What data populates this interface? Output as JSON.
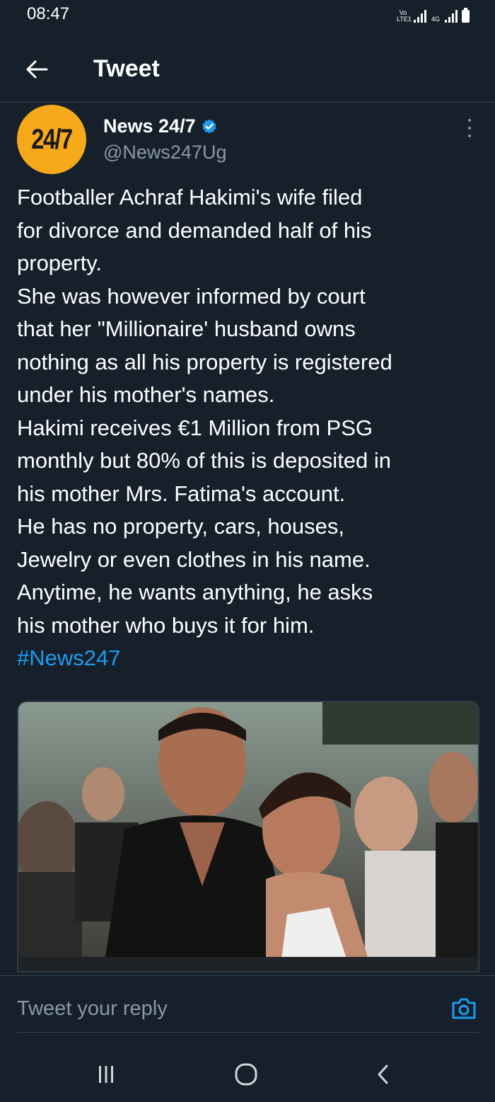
{
  "status_bar": {
    "time": "08:47",
    "carrier_tag_1": "Vo LTE1",
    "carrier_tag_2": "4G"
  },
  "header": {
    "title": "Tweet",
    "back_icon": "arrow-left-icon"
  },
  "tweet": {
    "avatar_text": "24/7",
    "display_name": "News 24/7",
    "verified_icon": "verified-badge-icon",
    "handle": "@News247Ug",
    "body_lines": [
      "Footballer Achraf Hakimi's wife filed",
      "for divorce and demanded half of his",
      "property.",
      "She was however informed by court",
      "that her \"Millionaire' husband owns",
      "nothing as all his property is registered",
      "under his mother's names.",
      "Hakimi receives €1 Million from PSG",
      "monthly but 80% of this is deposited in",
      "his mother Mrs. Fatima's account.",
      "He has no property, cars, houses,",
      "Jewelry or even clothes in his name.",
      "Anytime, he wants anything, he asks",
      "his mother who buys it for him."
    ],
    "hashtag": "#News247",
    "media_icon": "photo-couple-red-carpet"
  },
  "reply": {
    "placeholder": "Tweet your reply",
    "camera_icon": "camera-icon"
  },
  "nav": {
    "recents_icon": "recents-icon",
    "home_icon": "home-icon",
    "back_icon": "back-chevron-icon"
  },
  "colors": {
    "background": "#15202b",
    "accent": "#1d9bf0",
    "muted": "#8b98a5",
    "avatar": "#f7a91c"
  }
}
